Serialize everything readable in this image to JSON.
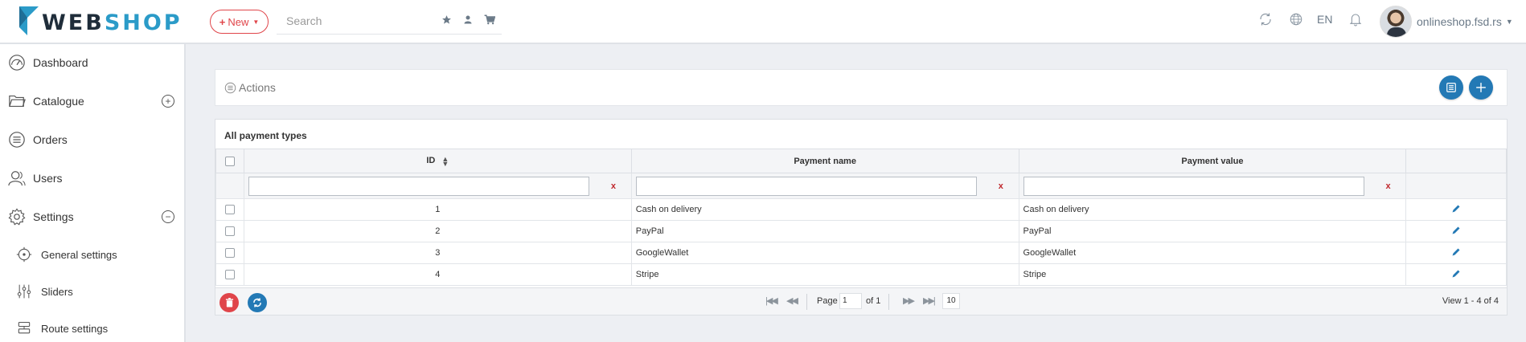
{
  "header": {
    "logo_text_web": "WEB",
    "logo_text_shop": "SHOP",
    "new_button_label": "New",
    "search_placeholder": "Search",
    "language": "EN",
    "user_name": "onlineshop.fsd.rs",
    "accent_color": "#2b9bc8",
    "new_button_color": "#e0454a"
  },
  "sidebar": {
    "items": [
      {
        "label": "Dashboard",
        "icon": "dashboard-icon"
      },
      {
        "label": "Catalogue",
        "icon": "folder-icon",
        "toggle": "+"
      },
      {
        "label": "Orders",
        "icon": "list-icon"
      },
      {
        "label": "Users",
        "icon": "user-icon"
      },
      {
        "label": "Settings",
        "icon": "gear-icon",
        "toggle": "−"
      }
    ],
    "subitems": [
      {
        "label": "General settings",
        "icon": "general-settings-icon"
      },
      {
        "label": "Sliders",
        "icon": "sliders-icon"
      },
      {
        "label": "Route settings",
        "icon": "route-icon"
      }
    ]
  },
  "actions": {
    "label": "Actions"
  },
  "grid": {
    "caption": "All payment types",
    "columns": [
      "ID",
      "Payment name",
      "Payment value"
    ],
    "rows": [
      {
        "id": "1",
        "name": "Cash on delivery",
        "value": "Cash on delivery"
      },
      {
        "id": "2",
        "name": "PayPal",
        "value": "PayPal"
      },
      {
        "id": "3",
        "name": "GoogleWallet",
        "value": "GoogleWallet"
      },
      {
        "id": "4",
        "name": "Stripe",
        "value": "Stripe"
      }
    ],
    "clear_label": "x",
    "pager": {
      "page_label": "Page",
      "page_value": "1",
      "of_label": "of 1",
      "rows_per_page": "10",
      "view_text": "View 1 - 4 of 4"
    }
  }
}
